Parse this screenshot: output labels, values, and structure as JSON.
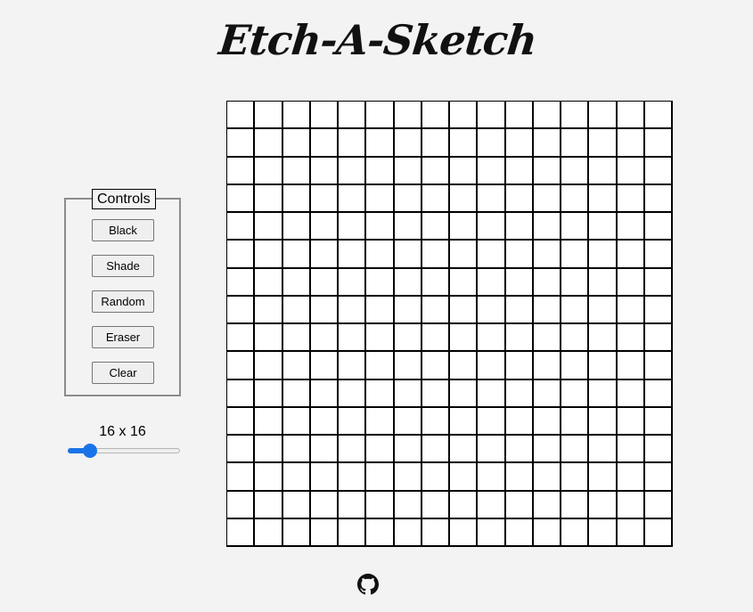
{
  "title": "Etch-A-Sketch",
  "controls": {
    "legend": "Controls",
    "buttons": [
      {
        "id": "black",
        "label": "Black"
      },
      {
        "id": "shade",
        "label": "Shade"
      },
      {
        "id": "random",
        "label": "Random"
      },
      {
        "id": "eraser",
        "label": "Eraser"
      },
      {
        "id": "clear",
        "label": "Clear"
      }
    ]
  },
  "grid_size": {
    "label": "16 x 16",
    "value": 16,
    "min": 1,
    "max": 100,
    "accent": "#1a73e8"
  },
  "grid": {
    "rows": 16,
    "cols": 16,
    "cell_color": "#ffffff",
    "line_color": "#000000"
  },
  "footer": {
    "icon": "github-icon"
  }
}
